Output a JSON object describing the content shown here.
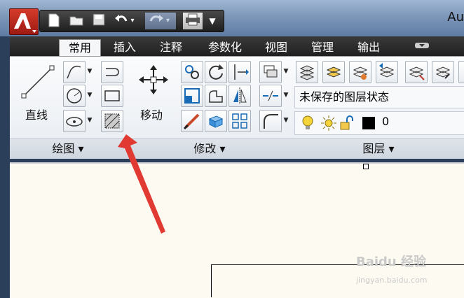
{
  "app": {
    "title": "Au"
  },
  "tabs": [
    {
      "label": "常用",
      "active": true
    },
    {
      "label": "插入"
    },
    {
      "label": "注释"
    },
    {
      "label": "参数化"
    },
    {
      "label": "视图"
    },
    {
      "label": "管理"
    },
    {
      "label": "输出"
    }
  ],
  "panels": {
    "draw": {
      "title": "绘图",
      "line_label": "直线"
    },
    "modify": {
      "title": "修改",
      "move_label": "移动"
    },
    "layers": {
      "title": "图层",
      "state_text": "未保存的图层状态",
      "current_layer": "0"
    }
  },
  "watermark": {
    "line1": "Baidu 经验",
    "line2": "jingyan.baidu.com"
  },
  "colors": {
    "accent_arrow": "#e03a33",
    "layer_color": "#000000"
  }
}
